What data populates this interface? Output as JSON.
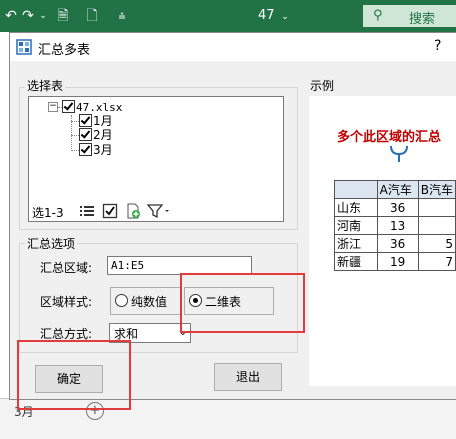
{
  "ribbon": {
    "title": "47",
    "search_label": "搜索"
  },
  "dialog": {
    "title": "汇总多表",
    "help": "?",
    "select_group_label": "选择表",
    "tree": {
      "file": "47.xlsx",
      "sheets": [
        "1月",
        "2月",
        "3月"
      ]
    },
    "selection_count": "选1-3",
    "options_group_label": "汇总选项",
    "range_label": "汇总区域:",
    "range_value": "A1:E5",
    "style_label": "区域样式:",
    "style_options": [
      "纯数值",
      "二维表"
    ],
    "style_selected": "二维表",
    "method_label": "汇总方式:",
    "method_value": "求和",
    "ok_button": "确定",
    "exit_button": "退出",
    "preview_label": "示例",
    "preview": {
      "caption": "多个此区域的汇总",
      "headers": [
        "",
        "A汽车",
        "B汽车"
      ],
      "rows": [
        [
          "山东",
          "36",
          ""
        ],
        [
          "河南",
          "13",
          ""
        ],
        [
          "浙江",
          "36",
          "5"
        ],
        [
          "新疆",
          "19",
          "7"
        ]
      ]
    }
  },
  "excel": {
    "sheet_tab": "3月",
    "add_sheet": "+"
  },
  "colors": {
    "ribbon_green": "#217346",
    "annotation_red": "#e03c3c",
    "caption_red": "#c00000"
  }
}
